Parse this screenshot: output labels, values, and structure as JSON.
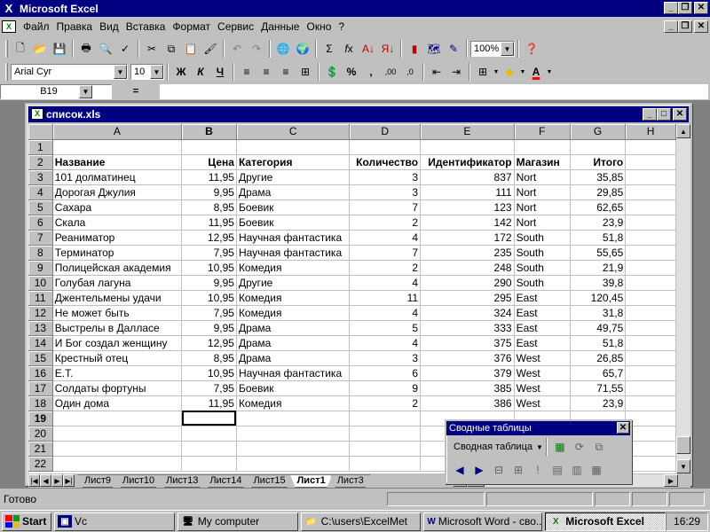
{
  "app": {
    "title": "Microsoft Excel"
  },
  "menu": [
    "Файл",
    "Правка",
    "Вид",
    "Вставка",
    "Формат",
    "Сервис",
    "Данные",
    "Окно",
    "?"
  ],
  "toolbar": {
    "zoom": "100%",
    "font_name": "Arial Cyr",
    "font_size": "10",
    "bold": "Ж",
    "italic": "К",
    "underline": "Ч"
  },
  "formula_bar": {
    "name_box": "B19",
    "equals": "=",
    "value": ""
  },
  "workbook": {
    "title": "список.xls",
    "columns": [
      "A",
      "B",
      "C",
      "D",
      "E",
      "F",
      "G",
      "H"
    ],
    "rows": [
      [
        "1",
        "",
        "",
        "",
        "",
        "",
        "",
        ""
      ],
      [
        "2",
        "Название",
        "Цена",
        "Категория",
        "Количество",
        "Идентификатор",
        "Магазин",
        "Итого"
      ],
      [
        "3",
        "101 долматинец",
        "11,95",
        "Другие",
        "3",
        "837",
        "Nort",
        "35,85"
      ],
      [
        "4",
        "Дорогая Джулия",
        "9,95",
        "Драма",
        "3",
        "111",
        "Nort",
        "29,85"
      ],
      [
        "5",
        "Сахара",
        "8,95",
        "Боевик",
        "7",
        "123",
        "Nort",
        "62,65"
      ],
      [
        "6",
        "Скала",
        "11,95",
        "Боевик",
        "2",
        "142",
        "Nort",
        "23,9"
      ],
      [
        "7",
        "Реаниматор",
        "12,95",
        "Научная фантастика",
        "4",
        "172",
        "South",
        "51,8"
      ],
      [
        "8",
        "Терминатор",
        "7,95",
        "Научная фантастика",
        "7",
        "235",
        "South",
        "55,65"
      ],
      [
        "9",
        "Полицейская академия",
        "10,95",
        "Комедия",
        "2",
        "248",
        "South",
        "21,9"
      ],
      [
        "10",
        "Голубая лагуна",
        "9,95",
        "Другие",
        "4",
        "290",
        "South",
        "39,8"
      ],
      [
        "11",
        "Джентельмены удачи",
        "10,95",
        "Комедия",
        "11",
        "295",
        "East",
        "120,45"
      ],
      [
        "12",
        "Не может быть",
        "7,95",
        "Комедия",
        "4",
        "324",
        "East",
        "31,8"
      ],
      [
        "13",
        "Выстрелы в Далласе",
        "9,95",
        "Драма",
        "5",
        "333",
        "East",
        "49,75"
      ],
      [
        "14",
        "И Бог создал женщину",
        "12,95",
        "Драма",
        "4",
        "375",
        "East",
        "51,8"
      ],
      [
        "15",
        "Крестный отец",
        "8,95",
        "Драма",
        "3",
        "376",
        "West",
        "26,85"
      ],
      [
        "16",
        "Е.Т.",
        "10,95",
        "Научная фантастика",
        "6",
        "379",
        "West",
        "65,7"
      ],
      [
        "17",
        "Солдаты фортуны",
        "7,95",
        "Боевик",
        "9",
        "385",
        "West",
        "71,55"
      ],
      [
        "18",
        "Один дома",
        "11,95",
        "Комедия",
        "2",
        "386",
        "West",
        "23,9"
      ],
      [
        "19",
        "",
        "",
        "",
        "",
        "",
        "",
        ""
      ],
      [
        "20",
        "",
        "",
        "",
        "",
        "",
        "",
        ""
      ],
      [
        "21",
        "",
        "",
        "",
        "",
        "",
        "",
        ""
      ],
      [
        "22",
        "",
        "",
        "",
        "",
        "",
        "",
        ""
      ]
    ],
    "sheets": [
      "Лист9",
      "Лист10",
      "Лист13",
      "Лист14",
      "Лист15",
      "Лист1",
      "Лист3"
    ],
    "active_sheet": "Лист1"
  },
  "pivot_toolbar": {
    "title": "Сводные таблицы",
    "dropdown": "Сводная таблица"
  },
  "status": {
    "text": "Готово"
  },
  "taskbar": {
    "start": "Start",
    "items": [
      "Vc",
      "My computer",
      "C:\\users\\ExcelMet",
      "Microsoft Word - сво...",
      "Microsoft Excel"
    ],
    "clock": "16:29"
  },
  "colors": {
    "titlebar": "#000080",
    "desktop": "#008080",
    "face": "#c0c0c0"
  }
}
